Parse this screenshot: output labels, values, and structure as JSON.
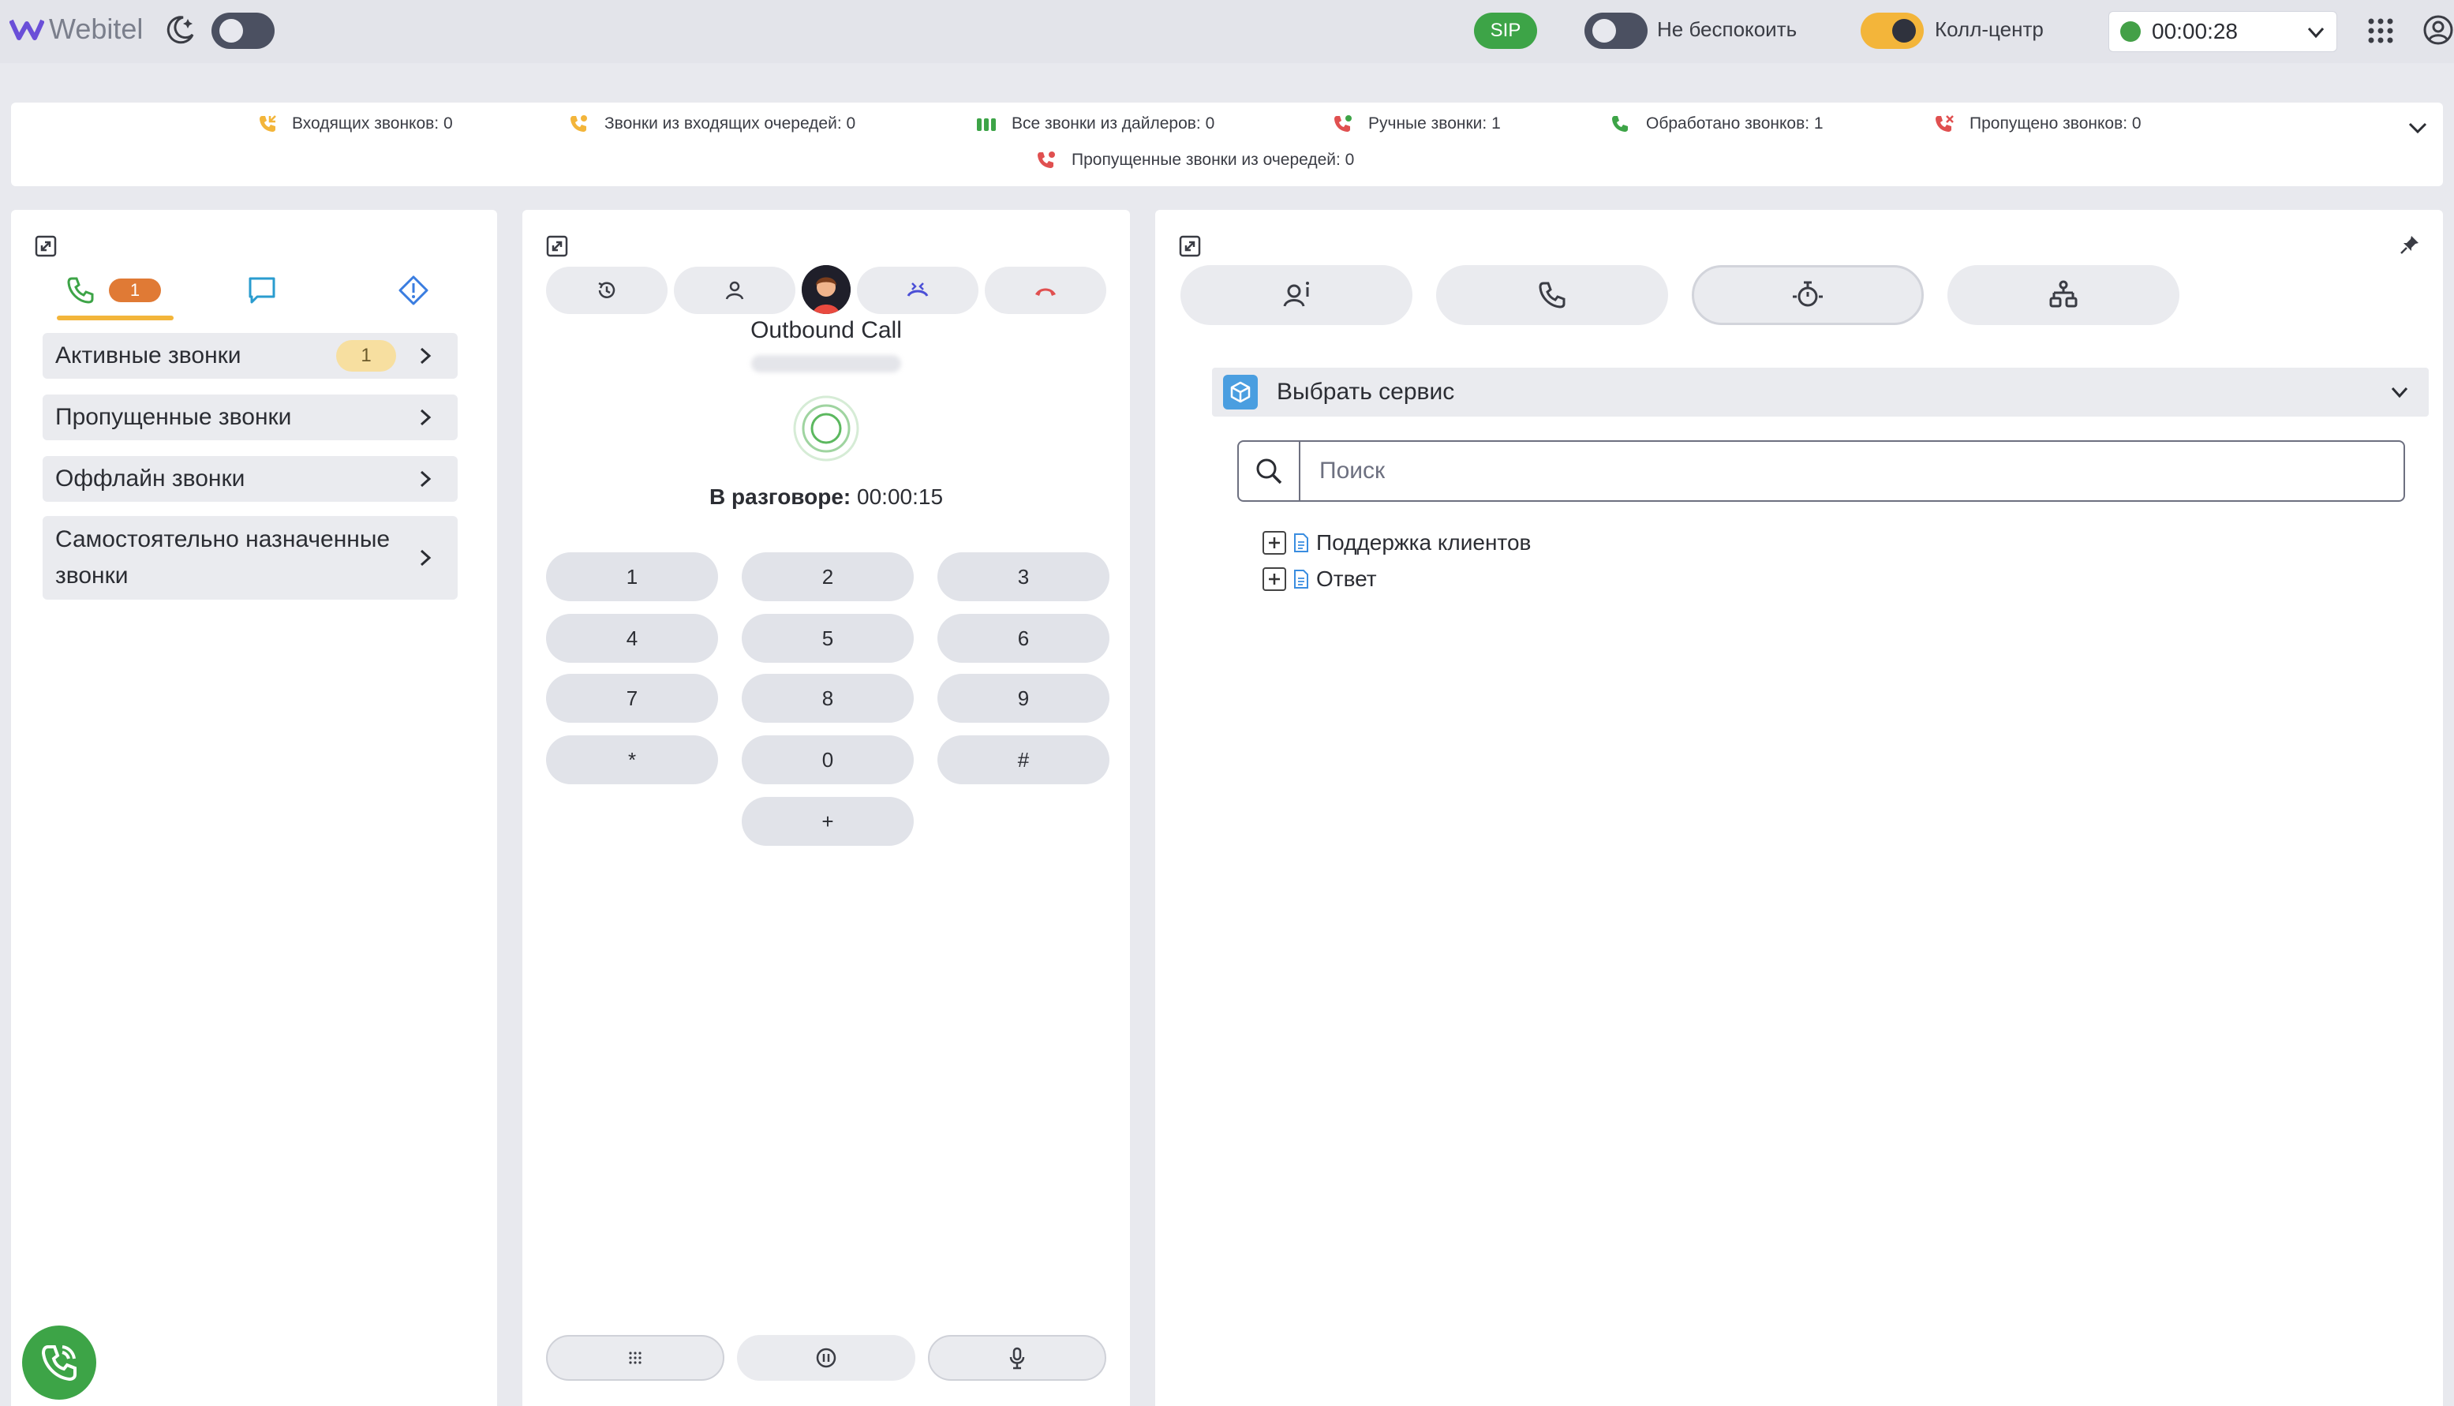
{
  "header": {
    "logo_text": "Webitel",
    "sip_label": "SIP",
    "dnd_label": "Не беспокоить",
    "callcenter_label": "Колл-центр",
    "status_timer": "00:00:28",
    "status_color": "#43a047"
  },
  "stats": [
    {
      "label": "Входящих звонков: 0",
      "icon": "incoming-call-icon",
      "color": "#f3b53a"
    },
    {
      "label": "Звонки из входящих очередей: 0",
      "icon": "queue-call-icon",
      "color": "#f3b53a"
    },
    {
      "label": "Все звонки из дайлеров: 0",
      "icon": "dialer-icon",
      "color": "#3da447"
    },
    {
      "label": "Ручные звонки: 1",
      "icon": "manual-call-icon",
      "color": "#e05050"
    },
    {
      "label": "Обработано звонков: 1",
      "icon": "handled-call-icon",
      "color": "#3da447"
    },
    {
      "label": "Пропущено звонков: 0",
      "icon": "missed-call-icon",
      "color": "#e05050"
    },
    {
      "label": "Пропущенные звонки из очередей: 0",
      "icon": "missed-queue-call-icon",
      "color": "#e05050"
    }
  ],
  "left_panel": {
    "tab_badge": "1",
    "items": [
      {
        "label": "Активные звонки",
        "badge": "1"
      },
      {
        "label": "Пропущенные звонки"
      },
      {
        "label": "Оффлайн звонки"
      },
      {
        "label": "Самостоятельно назначенные звонки"
      }
    ]
  },
  "call_panel": {
    "title": "Outbound Call",
    "talk_label": "В разговоре:",
    "talk_time": "00:00:15",
    "keypad": [
      "1",
      "2",
      "3",
      "4",
      "5",
      "6",
      "7",
      "8",
      "9",
      "*",
      "0",
      "#",
      "+"
    ]
  },
  "right_panel": {
    "service_select": "Выбрать сервис",
    "search_placeholder": "Поиск",
    "tree": [
      "Поддержка клиентов",
      "Ответ"
    ]
  }
}
